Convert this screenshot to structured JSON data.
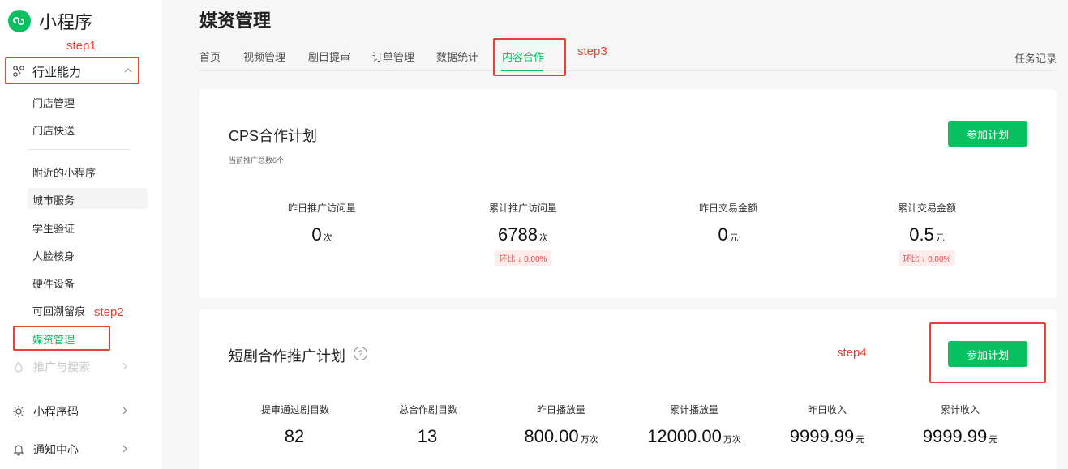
{
  "app": {
    "title": "小程序"
  },
  "annotations": {
    "step1": "step1",
    "step2": "step2",
    "step3": "step3",
    "step4": "step4"
  },
  "sidebar": {
    "group": {
      "label": "行业能力",
      "icon": "branch-icon"
    },
    "items": [
      {
        "label": "门店管理"
      },
      {
        "label": "门店快送"
      },
      {
        "label": "附近的小程序"
      },
      {
        "label": "城市服务"
      },
      {
        "label": "学生验证"
      },
      {
        "label": "人脸核身"
      },
      {
        "label": "硬件设备"
      },
      {
        "label": "可回溯留痕"
      },
      {
        "label": "媒资管理"
      }
    ],
    "bottom": [
      {
        "label": "推广与搜索",
        "icon": "promotion-icon"
      },
      {
        "label": "小程序码",
        "icon": "sun-icon"
      },
      {
        "label": "通知中心",
        "icon": "bell-icon"
      }
    ]
  },
  "main": {
    "title": "媒资管理",
    "tabs": [
      {
        "label": "首页"
      },
      {
        "label": "视频管理"
      },
      {
        "label": "剧目提审"
      },
      {
        "label": "订单管理"
      },
      {
        "label": "数据统计"
      },
      {
        "label": "内容合作"
      }
    ],
    "task_link": "任务记录"
  },
  "cps": {
    "title": "CPS合作计划",
    "subtitle": "当前推广总数6个",
    "button": "参加计划",
    "stats": [
      {
        "label": "昨日推广访问量",
        "value": "0",
        "unit": "次",
        "chip": ""
      },
      {
        "label": "累计推广访问量",
        "value": "6788",
        "unit": "次",
        "chip": "环比 ↓ 0.00%"
      },
      {
        "label": "昨日交易金额",
        "value": "0",
        "unit": "元",
        "chip": ""
      },
      {
        "label": "累计交易金额",
        "value": "0.5",
        "unit": "元",
        "chip": "环比 ↓ 0.00%"
      }
    ]
  },
  "drama": {
    "title": "短剧合作推广计划",
    "help": "?",
    "button": "参加计划",
    "stats": [
      {
        "label": "提审通过剧目数",
        "value": "82",
        "unit": ""
      },
      {
        "label": "总合作剧目数",
        "value": "13",
        "unit": ""
      },
      {
        "label": "昨日播放量",
        "value": "800.00",
        "unit": "万次"
      },
      {
        "label": "累计播放量",
        "value": "12000.00",
        "unit": "万次"
      },
      {
        "label": "昨日收入",
        "value": "9999.99",
        "unit": "元"
      },
      {
        "label": "累计收入",
        "value": "9999.99",
        "unit": "元"
      }
    ]
  },
  "colors": {
    "accent": "#07c160",
    "annotation": "#e8412f",
    "chip_text": "#e84545"
  }
}
